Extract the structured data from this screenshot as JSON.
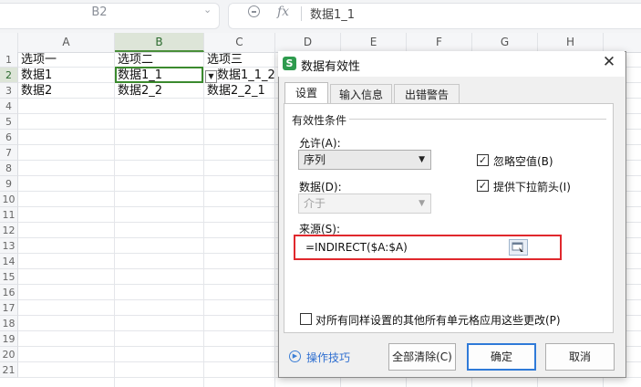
{
  "namebox": {
    "value": "B2"
  },
  "formula_bar": {
    "fx_label": "fx",
    "value": "数据1_1"
  },
  "columns": [
    "A",
    "B",
    "C",
    "D",
    "E",
    "F",
    "G",
    "H"
  ],
  "rows": [
    "1",
    "2",
    "3",
    "4",
    "5",
    "6",
    "7",
    "8",
    "9",
    "10",
    "11",
    "12",
    "13",
    "14",
    "15",
    "16",
    "17",
    "18",
    "19",
    "20",
    "21"
  ],
  "cells": {
    "A1": "选项一",
    "B1": "选项二",
    "C1": "选项三",
    "A2": "数据1",
    "B2": "数据1_1",
    "C2": "数据1_1_2",
    "A3": "数据2",
    "B3": "数据2_2",
    "C3": "数据2_2_1"
  },
  "dialog": {
    "title": "数据有效性",
    "app_icon_letter": "S",
    "tabs": [
      "设置",
      "输入信息",
      "出错警告"
    ],
    "group_title": "有效性条件",
    "allow_label": "允许(A):",
    "allow_value": "序列",
    "data_label": "数据(D):",
    "data_value": "介于",
    "ignore_blank_label": "忽略空值(B)",
    "ignore_blank_checked": true,
    "dropdown_arrow_label": "提供下拉箭头(I)",
    "dropdown_arrow_checked": true,
    "source_label": "来源(S):",
    "source_value": "=INDIRECT($A:$A)",
    "apply_all_label": "对所有同样设置的其他所有单元格应用这些更改(P)",
    "apply_all_checked": false,
    "tips_link": "操作技巧",
    "clear_all_button": "全部清除(C)",
    "ok_button": "确定",
    "cancel_button": "取消"
  }
}
